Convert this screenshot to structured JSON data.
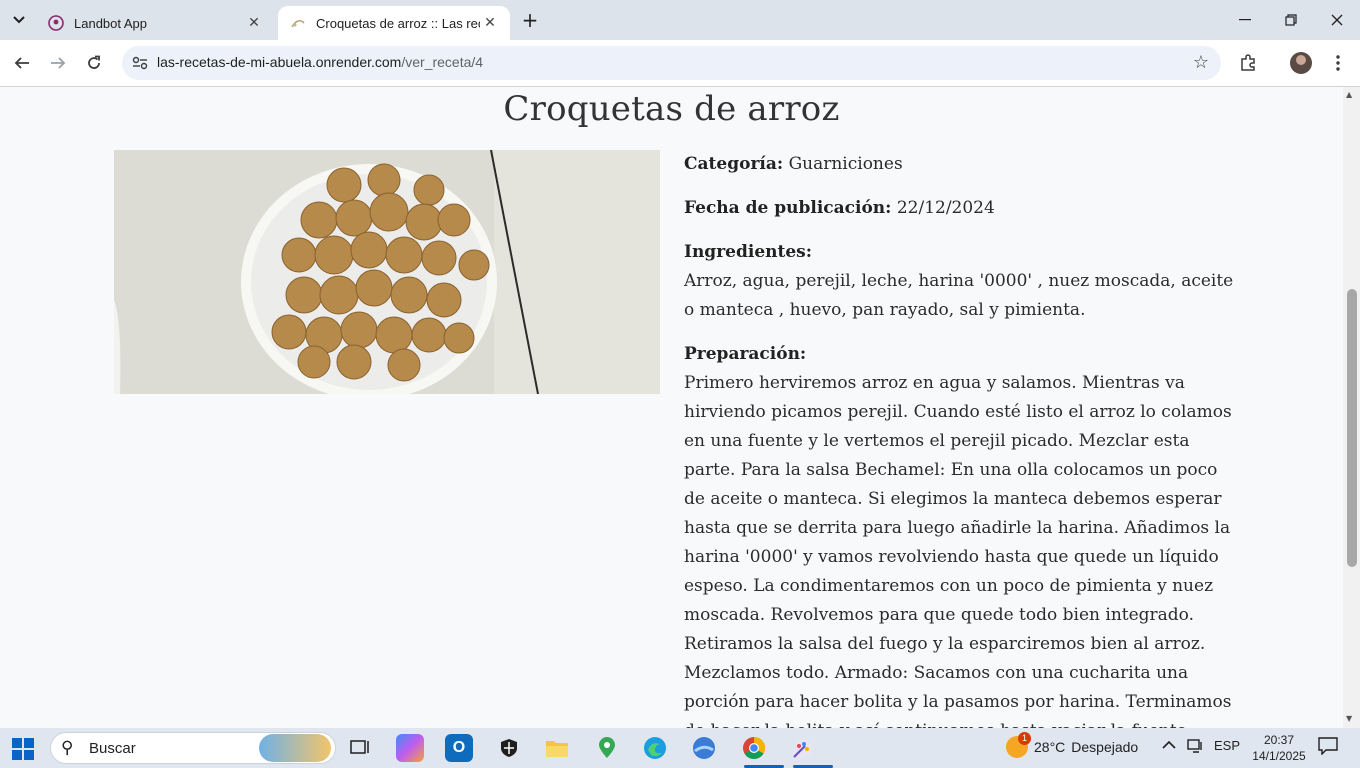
{
  "browser": {
    "tabs": [
      {
        "title": "Landbot App",
        "icon": "landbot-favicon"
      },
      {
        "title": "Croquetas de arroz :: Las recetas",
        "icon": "recipe-favicon"
      }
    ],
    "url": {
      "host": "las-recetas-de-mi-abuela.onrender.com",
      "path": "/ver_receta/4"
    }
  },
  "recipe": {
    "title": "Croquetas de arroz",
    "category_label": "Categoría:",
    "category": "Guarniciones",
    "date_label": "Fecha de publicación:",
    "date": "22/12/2024",
    "ingredients_label": "Ingredientes:",
    "ingredients": "Arroz, agua, perejil, leche, harina '0000' , nuez moscada, aceite o manteca , huevo, pan rayado, sal y pimienta.",
    "preparation_label": "Preparación:",
    "preparation": "Primero herviremos arroz en agua y salamos. Mientras va hirviendo picamos perejil. Cuando esté listo el arroz lo colamos en una fuente y le vertemos el perejil picado. Mezclar esta parte. Para la salsa Bechamel: En una olla colocamos un poco de aceite o manteca. Si elegimos la manteca debemos esperar hasta que se derrita para luego añadirle la harina. Añadimos la harina '0000' y vamos revolviendo hasta que quede un líquido espeso. La condimentaremos con un poco de pimienta y nuez moscada. Revolvemos para que quede todo bien integrado. Retiramos la salsa del fuego y la esparciremos bien al arroz. Mezclamos todo. Armado: Sacamos con una cucharita una porción para hacer bolita y la pasamos por harina. Terminamos de hacer la bolita y así continuamos hasta vaciar la fuente. Luego"
  },
  "taskbar": {
    "search_placeholder": "Buscar",
    "weather": {
      "temp": "28°C",
      "condition": "Despejado",
      "badge": "1"
    },
    "language": "ESP",
    "time": "20:37",
    "date": "14/1/2025"
  },
  "colors": {
    "accent": "#0a64c8",
    "page_bg": "#f8f9fa",
    "tab_strip": "#dde3ea"
  }
}
